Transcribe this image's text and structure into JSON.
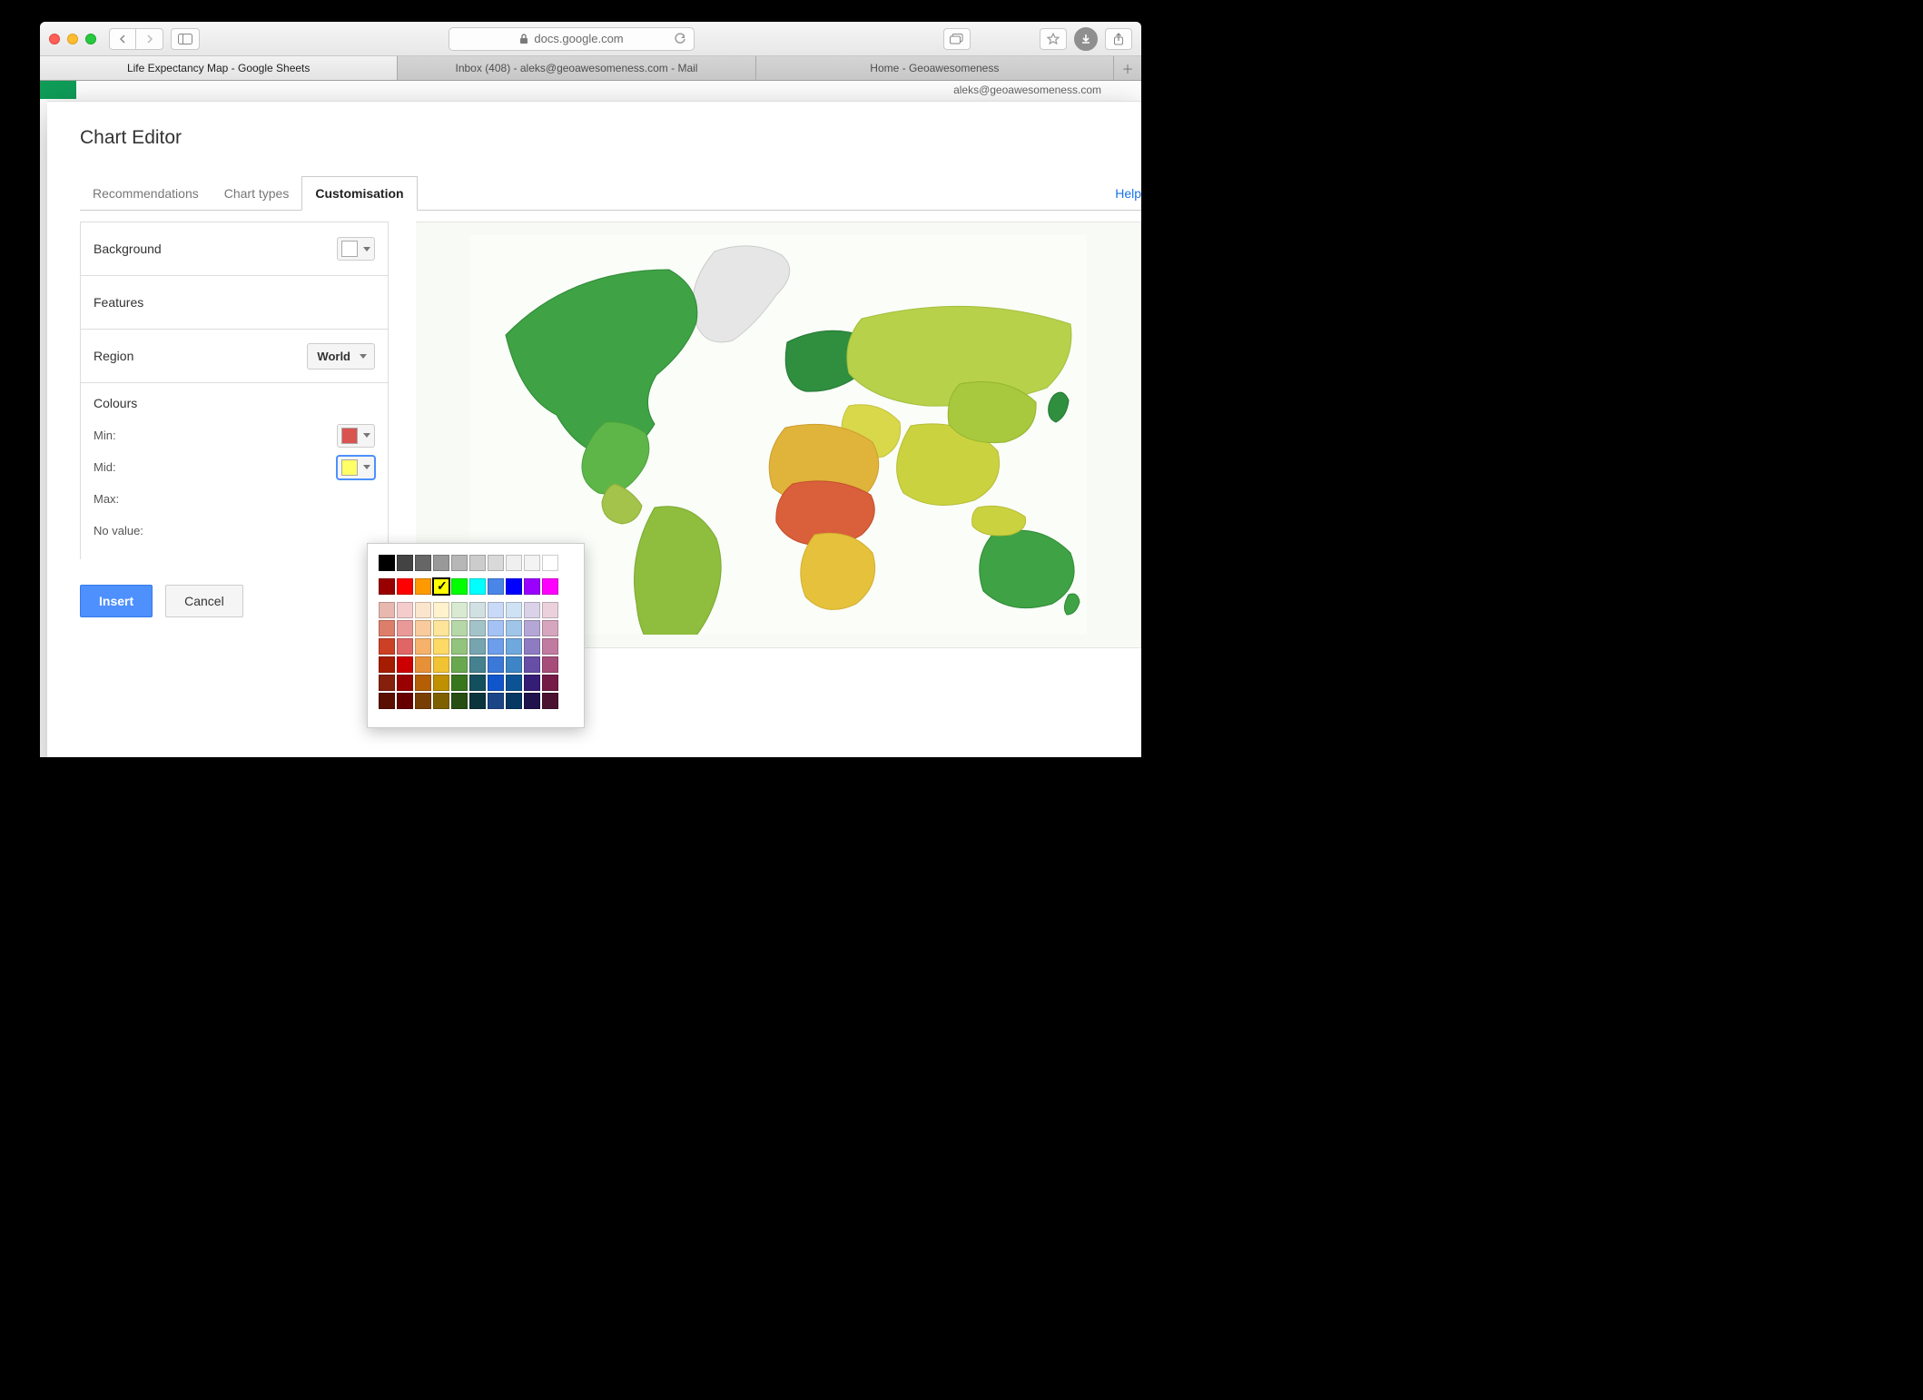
{
  "browser": {
    "url_label": "docs.google.com",
    "tabs": [
      "Life Expectancy Map - Google Sheets",
      "Inbox (408) - aleks@geoawesomeness.com - Mail",
      "Home - Geoawesomeness"
    ],
    "account": "aleks@geoawesomeness.com"
  },
  "editor": {
    "title": "Chart Editor",
    "tabs": {
      "recommendations": "Recommendations",
      "chart_types": "Chart types",
      "customisation": "Customisation"
    },
    "help": "Help",
    "sections": {
      "background": "Background",
      "features": "Features",
      "region": "Region",
      "region_value": "World",
      "colours": "Colours",
      "min": "Min:",
      "mid": "Mid:",
      "max": "Max:",
      "no_value": "No value:"
    },
    "swatches": {
      "background": "#ffffff",
      "min": "#d9534f",
      "mid": "#ffff66"
    },
    "buttons": {
      "insert": "Insert",
      "cancel": "Cancel"
    }
  },
  "palette": {
    "selected": "#ffff00",
    "grays": [
      "#000000",
      "#434343",
      "#666666",
      "#999999",
      "#b7b7b7",
      "#cccccc",
      "#d9d9d9",
      "#efefef",
      "#f3f3f3",
      "#ffffff"
    ],
    "base": [
      "#980000",
      "#ff0000",
      "#ff9900",
      "#ffff00",
      "#00ff00",
      "#00ffff",
      "#4a86e8",
      "#0000ff",
      "#9900ff",
      "#ff00ff"
    ],
    "tints": [
      [
        "#e6b8af",
        "#f4cccc",
        "#fce5cd",
        "#fff2cc",
        "#d9ead3",
        "#d0e0e3",
        "#c9daf8",
        "#cfe2f3",
        "#d9d2e9",
        "#ead1dc"
      ],
      [
        "#dd7e6b",
        "#ea9999",
        "#f9cb9c",
        "#ffe599",
        "#b6d7a8",
        "#a2c4c9",
        "#a4c2f4",
        "#9fc5e8",
        "#b4a7d6",
        "#d5a6bd"
      ],
      [
        "#cc4125",
        "#e06666",
        "#f6b26b",
        "#ffd966",
        "#93c47d",
        "#76a5af",
        "#6d9eeb",
        "#6fa8dc",
        "#8e7cc3",
        "#c27ba0"
      ],
      [
        "#a61c00",
        "#cc0000",
        "#e69138",
        "#f1c232",
        "#6aa84f",
        "#45818e",
        "#3c78d8",
        "#3d85c6",
        "#674ea7",
        "#a64d79"
      ],
      [
        "#85200c",
        "#990000",
        "#b45f06",
        "#bf9000",
        "#38761d",
        "#134f5c",
        "#1155cc",
        "#0b5394",
        "#351c75",
        "#741b47"
      ],
      [
        "#5b0f00",
        "#660000",
        "#783f04",
        "#7f6000",
        "#274e13",
        "#0c343d",
        "#1c4587",
        "#073763",
        "#20124d",
        "#4c1130"
      ]
    ]
  },
  "chart_data": {
    "type": "area",
    "title": "Life Expectancy Map",
    "region": "World",
    "legend_gradient": {
      "min_color": "#d9534f",
      "mid_color": "#ffff66",
      "max_color": "#0f9d58"
    },
    "note": "Choropleth world map; exact per-country values not readable from screenshot"
  }
}
